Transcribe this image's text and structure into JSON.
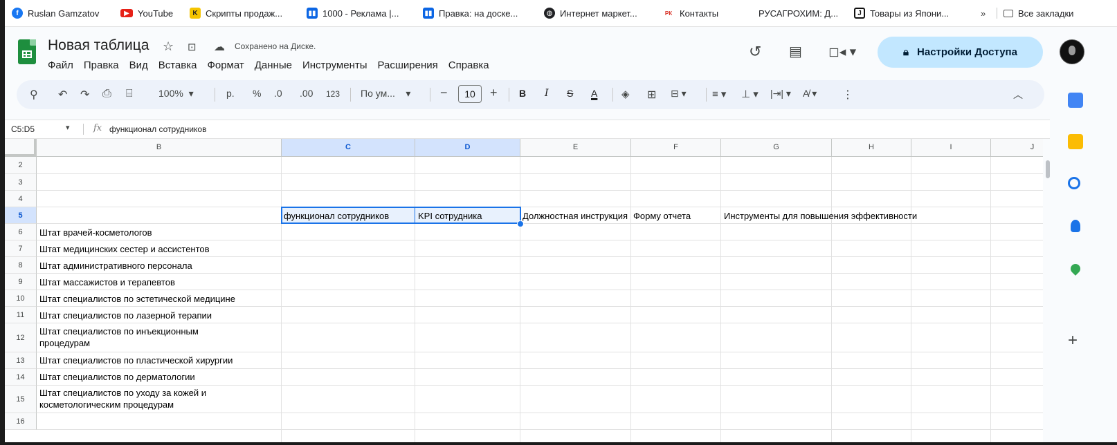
{
  "bookmarks": [
    {
      "label": "Ruslan Gamzatov",
      "icon": "facebook-icon"
    },
    {
      "label": "YouTube",
      "icon": "youtube-icon"
    },
    {
      "label": "Скрипты продаж...",
      "icon": "k-icon"
    },
    {
      "label": "1000 - Реклама |...",
      "icon": "trello-icon"
    },
    {
      "label": "Правка: на доске...",
      "icon": "trello-icon"
    },
    {
      "label": "Интернет маркет...",
      "icon": "globe-icon"
    },
    {
      "label": "Контакты",
      "icon": "rk-icon",
      "icon_text": "РК"
    },
    {
      "label": "РУСАГРОХИМ: Д...",
      "icon": ""
    },
    {
      "label": "Товары из Япони...",
      "icon": "j-icon"
    }
  ],
  "bookmarks_overflow": "»",
  "all_bookmarks": "Все закладки",
  "doc": {
    "title": "Новая таблица",
    "saved_status": "Сохранено на Диске."
  },
  "menu": [
    "Файл",
    "Правка",
    "Вид",
    "Вставка",
    "Формат",
    "Данные",
    "Инструменты",
    "Расширения",
    "Справка"
  ],
  "share_button": "Настройки Доступа",
  "toolbar": {
    "zoom": "100%",
    "currency": "р.",
    "percent": "%",
    "dec_decrease": ".0",
    "dec_increase": ".00",
    "number_format": "123",
    "font": "По ум...",
    "font_size": "10",
    "bold": "B",
    "italic": "I",
    "strike": "S",
    "text_color": "A"
  },
  "formula_bar": {
    "name_box": "C5:D5",
    "fx": "fx",
    "content": "функционал сотрудников"
  },
  "columns": [
    "B",
    "C",
    "D",
    "E",
    "F",
    "G",
    "H",
    "I",
    "J"
  ],
  "selected_columns": [
    "C",
    "D"
  ],
  "rows": [
    "2",
    "3",
    "4",
    "5",
    "6",
    "7",
    "8",
    "9",
    "10",
    "11",
    "12",
    "13",
    "14",
    "15",
    "16"
  ],
  "selected_row": "5",
  "header_row_cells": {
    "C5": "функционал сотрудников",
    "D5": "KPI сотрудника",
    "E5": "Должностная инструкция",
    "F5": "Форму отчета",
    "G5": "Инструменты для повышения эффективности"
  },
  "b_column": [
    {
      "row": "6",
      "text": "Штат врачей-косметологов"
    },
    {
      "row": "7",
      "text": "Штат медицинских сестер и ассистентов"
    },
    {
      "row": "8",
      "text": "Штат административного персонала"
    },
    {
      "row": "9",
      "text": "Штат массажистов и терапевтов"
    },
    {
      "row": "10",
      "text": "Штат специалистов по эстетической медицине"
    },
    {
      "row": "11",
      "text": "Штат специалистов по лазерной терапии"
    },
    {
      "row": "12",
      "text": "Штат специалистов по инъекционным процедурам"
    },
    {
      "row": "13",
      "text": "Штат специалистов по пластической хирургии"
    },
    {
      "row": "14",
      "text": "Штат специалистов по дерматологии"
    },
    {
      "row": "15",
      "text": "Штат специалистов по уходу за кожей и косметологическим процедурам"
    }
  ],
  "colors": {
    "accent": "#1a73e8",
    "share_bg": "#c2e7ff",
    "sheets_green": "#1e8e3e"
  }
}
